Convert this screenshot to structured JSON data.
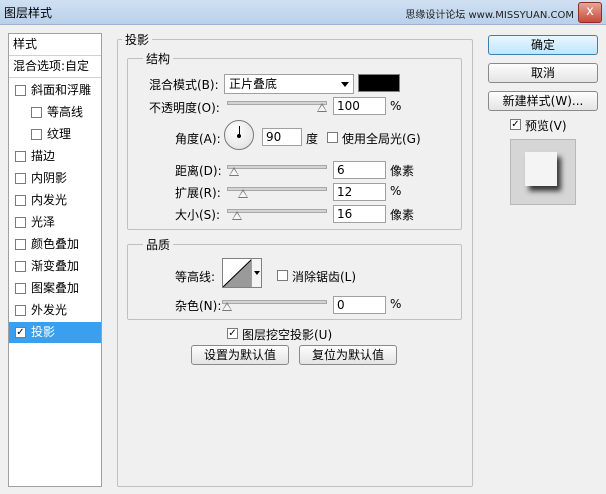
{
  "window": {
    "title": "图层样式",
    "watermark": "思缘设计论坛 www.MISSYUAN.COM",
    "close_symbol": "x"
  },
  "left_panel": {
    "styles_label": "样式",
    "blend_options_label": "混合选项:自定",
    "items": [
      {
        "label": "斜面和浮雕",
        "checked": false,
        "sub": false
      },
      {
        "label": "等高线",
        "checked": false,
        "sub": true
      },
      {
        "label": "纹理",
        "checked": false,
        "sub": true
      },
      {
        "label": "描边",
        "checked": false,
        "sub": false
      },
      {
        "label": "内阴影",
        "checked": false,
        "sub": false
      },
      {
        "label": "内发光",
        "checked": false,
        "sub": false
      },
      {
        "label": "光泽",
        "checked": false,
        "sub": false
      },
      {
        "label": "颜色叠加",
        "checked": false,
        "sub": false
      },
      {
        "label": "渐变叠加",
        "checked": false,
        "sub": false
      },
      {
        "label": "图案叠加",
        "checked": false,
        "sub": false
      },
      {
        "label": "外发光",
        "checked": false,
        "sub": false
      },
      {
        "label": "投影",
        "checked": true,
        "sub": false,
        "selected": true
      }
    ]
  },
  "drop_shadow": {
    "section_title": "投影",
    "structure": {
      "title": "结构",
      "blend_mode_label": "混合模式(B):",
      "blend_mode_value": "正片叠底",
      "shadow_color": "#000000",
      "opacity_label": "不透明度(O):",
      "opacity_value": "100",
      "opacity_unit": "%",
      "opacity_fraction": 1.0,
      "angle_label": "角度(A):",
      "angle_value": "90",
      "angle_unit": "度",
      "global_light_label": "使用全局光(G)",
      "global_light_checked": false,
      "distance_label": "距离(D):",
      "distance_value": "6",
      "distance_unit": "像素",
      "distance_fraction": 0.02,
      "spread_label": "扩展(R):",
      "spread_value": "12",
      "spread_unit": "%",
      "spread_fraction": 0.12,
      "size_label": "大小(S):",
      "size_value": "16",
      "size_unit": "像素",
      "size_fraction": 0.06
    },
    "quality": {
      "title": "品质",
      "contour_label": "等高线:",
      "antialias_label": "消除锯齿(L)",
      "antialias_checked": false,
      "noise_label": "杂色(N):",
      "noise_value": "0",
      "noise_unit": "%",
      "noise_fraction": 0.0
    },
    "knockout_label": "图层挖空投影(U)",
    "knockout_checked": true,
    "make_default_label": "设置为默认值",
    "reset_default_label": "复位为默认值"
  },
  "right_buttons": {
    "ok_label": "确定",
    "cancel_label": "取消",
    "new_style_label": "新建样式(W)...",
    "preview_label": "预览(V)",
    "preview_checked": true
  },
  "check_mark": "✓"
}
